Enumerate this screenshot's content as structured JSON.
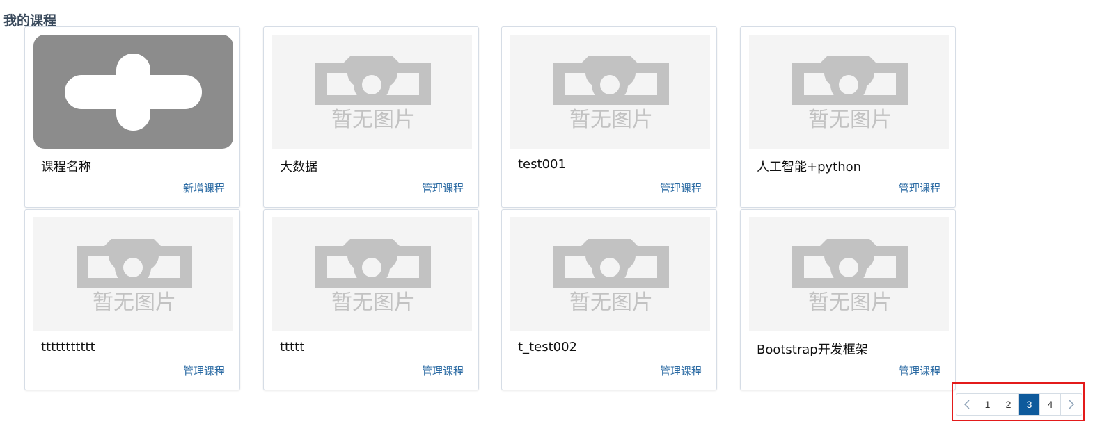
{
  "page": {
    "title": "我的课程"
  },
  "cards": [
    {
      "title": "课程名称",
      "action": "新增课程",
      "image": "add-placeholder"
    },
    {
      "title": "大数据",
      "action": "管理课程",
      "image": "no-image",
      "image_text": "暂无图片"
    },
    {
      "title": "test001",
      "action": "管理课程",
      "image": "no-image",
      "image_text": "暂无图片"
    },
    {
      "title": "人工智能+python",
      "action": "管理课程",
      "image": "no-image",
      "image_text": "暂无图片"
    },
    {
      "title": "ttttttttttt",
      "action": "管理课程",
      "image": "no-image",
      "image_text": "暂无图片"
    },
    {
      "title": "ttttt",
      "action": "管理课程",
      "image": "no-image",
      "image_text": "暂无图片"
    },
    {
      "title": "t_test002",
      "action": "管理课程",
      "image": "no-image",
      "image_text": "暂无图片"
    },
    {
      "title": "Bootstrap开发框架",
      "action": "管理课程",
      "image": "no-image",
      "image_text": "暂无图片"
    }
  ],
  "pagination": {
    "prev_icon": "chevron-left-icon",
    "next_icon": "chevron-right-icon",
    "pages": [
      "1",
      "2",
      "3",
      "4"
    ],
    "current": "3"
  },
  "colors": {
    "accent": "#0e5a9c",
    "link": "#2a6aa3",
    "highlight_box": "#e31b1b"
  }
}
